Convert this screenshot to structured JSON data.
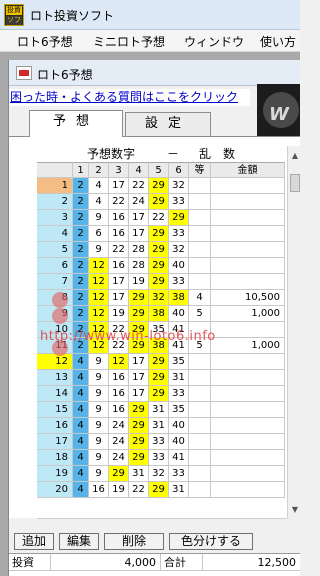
{
  "window": {
    "title": "ロト投資ソフト"
  },
  "menu": [
    "ロト6予想",
    "ミニロト予想",
    "ウィンドウ",
    "使い方"
  ],
  "child": {
    "title": "ロト6予想"
  },
  "help_link": "困った時・よくある質問はここをクリック",
  "tabs": [
    "予想",
    "設定"
  ],
  "grid": {
    "group_header": "予想数字",
    "dash": "－",
    "ransu": "乱　数",
    "columns": [
      "1",
      "2",
      "3",
      "4",
      "5",
      "6",
      "等",
      "金額"
    ],
    "rows": [
      [
        "1",
        "2",
        "4",
        "17",
        "22",
        "29",
        "32",
        "",
        ""
      ],
      [
        "2",
        "2",
        "4",
        "22",
        "24",
        "29",
        "33",
        "",
        ""
      ],
      [
        "3",
        "2",
        "9",
        "16",
        "17",
        "22",
        "29",
        "",
        ""
      ],
      [
        "4",
        "2",
        "6",
        "16",
        "17",
        "29",
        "33",
        "",
        ""
      ],
      [
        "5",
        "2",
        "9",
        "22",
        "28",
        "29",
        "32",
        "",
        ""
      ],
      [
        "6",
        "2",
        "12",
        "16",
        "28",
        "29",
        "40",
        "",
        ""
      ],
      [
        "7",
        "2",
        "12",
        "17",
        "19",
        "29",
        "33",
        "",
        ""
      ],
      [
        "8",
        "2",
        "12",
        "17",
        "29",
        "32",
        "38",
        "4",
        "10,500"
      ],
      [
        "9",
        "2",
        "12",
        "19",
        "29",
        "38",
        "40",
        "5",
        "1,000"
      ],
      [
        "10",
        "2",
        "12",
        "22",
        "29",
        "35",
        "41",
        "",
        ""
      ],
      [
        "11",
        "2",
        "12",
        "22",
        "29",
        "38",
        "41",
        "5",
        "1,000"
      ],
      [
        "12",
        "4",
        "9",
        "12",
        "17",
        "29",
        "35",
        "",
        ""
      ],
      [
        "13",
        "4",
        "9",
        "16",
        "17",
        "29",
        "31",
        "",
        ""
      ],
      [
        "14",
        "4",
        "9",
        "16",
        "17",
        "29",
        "33",
        "",
        ""
      ],
      [
        "15",
        "4",
        "9",
        "16",
        "29",
        "31",
        "35",
        "",
        ""
      ],
      [
        "16",
        "4",
        "9",
        "24",
        "29",
        "31",
        "40",
        "",
        ""
      ],
      [
        "17",
        "4",
        "9",
        "24",
        "29",
        "33",
        "40",
        "",
        ""
      ],
      [
        "18",
        "4",
        "9",
        "24",
        "29",
        "33",
        "41",
        "",
        ""
      ],
      [
        "19",
        "4",
        "9",
        "29",
        "31",
        "32",
        "33",
        "",
        ""
      ],
      [
        "20",
        "4",
        "16",
        "19",
        "22",
        "29",
        "31",
        "",
        ""
      ]
    ]
  },
  "buttons": [
    "追加",
    "編集",
    "削除",
    "色分けする"
  ],
  "summary": {
    "invest_label": "投資",
    "invest_value": "4,000",
    "total_label": "合計",
    "total_value": "12,500"
  },
  "watermark": "http://www.win-loto6.info",
  "banner_text": "W",
  "app_icon": {
    "top": "投資",
    "bottom": "ソフ"
  },
  "colors": {
    "highlight": "#ffff00",
    "col1": "#57b4e8",
    "row_header": "#bfe8f6",
    "selected_row": "#f4bd85",
    "link": "#0000cc"
  }
}
